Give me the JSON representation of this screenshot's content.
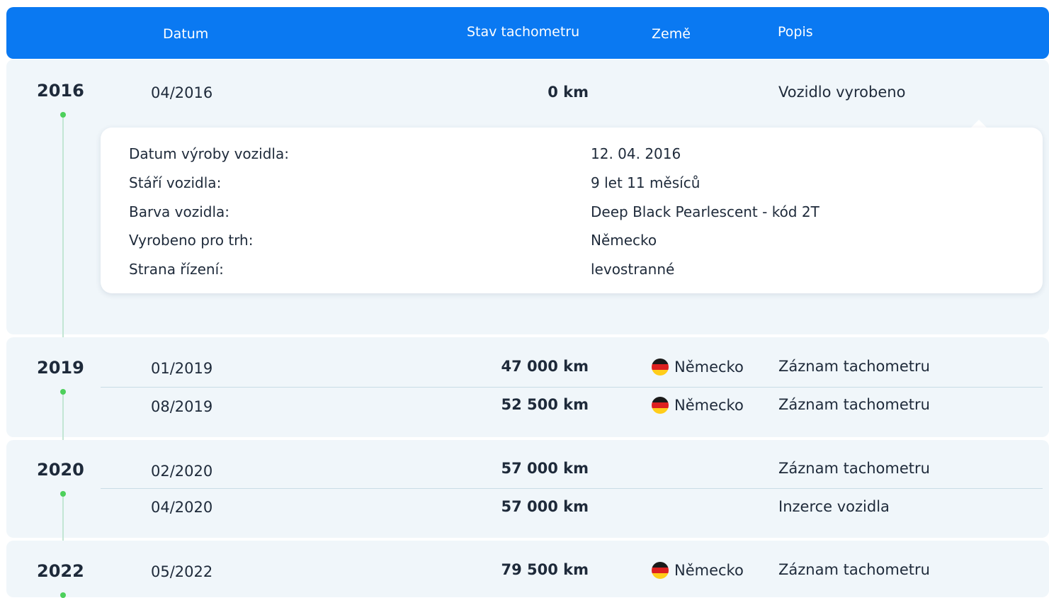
{
  "header": {
    "datum": "Datum",
    "stav": "Stav tachometru",
    "zeme": "Země",
    "popis": "Popis"
  },
  "sections": [
    {
      "year": "2016",
      "rows": [
        {
          "date": "04/2016",
          "km": "0 km",
          "country": "",
          "desc": "Vozidlo vyrobeno"
        }
      ],
      "details": [
        {
          "label": "Datum výroby vozidla:",
          "value": "12. 04. 2016"
        },
        {
          "label": "Stáří vozidla:",
          "value": "9 let 11 měsíců"
        },
        {
          "label": "Barva vozidla:",
          "value": "Deep Black Pearlescent - kód 2T"
        },
        {
          "label": "Vyrobeno pro trh:",
          "value": "Německo"
        },
        {
          "label": "Strana řízení:",
          "value": "levostranné"
        }
      ]
    },
    {
      "year": "2019",
      "rows": [
        {
          "date": "01/2019",
          "km": "47 000 km",
          "country": "Německo",
          "desc": "Záznam tachometru"
        },
        {
          "date": "08/2019",
          "km": "52 500 km",
          "country": "Německo",
          "desc": "Záznam tachometru"
        }
      ]
    },
    {
      "year": "2020",
      "rows": [
        {
          "date": "02/2020",
          "km": "57 000 km",
          "country": "",
          "desc": "Záznam tachometru"
        },
        {
          "date": "04/2020",
          "km": "57 000 km",
          "country": "",
          "desc": "Inzerce vozidla"
        }
      ]
    },
    {
      "year": "2022",
      "rows": [
        {
          "date": "05/2022",
          "km": "79 500 km",
          "country": "Německo",
          "desc": "Záznam tachometru"
        }
      ]
    }
  ],
  "colors": {
    "header_bg": "#0a79f2",
    "section_bg": "#f0f6fa",
    "timeline_dot": "#4dd05b",
    "text": "#1e2a3a"
  }
}
